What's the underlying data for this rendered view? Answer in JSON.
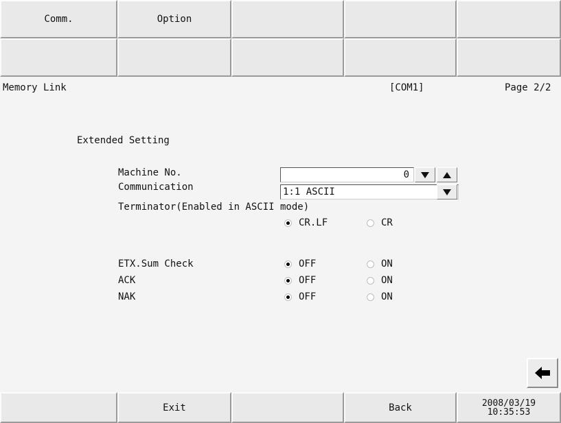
{
  "top_tabs": [
    "Comm.",
    "Option",
    "",
    "",
    ""
  ],
  "second_row": [
    "",
    "",
    "",
    "",
    ""
  ],
  "header": {
    "title": "Memory Link",
    "port": "[COM1]",
    "page": "Page 2/2"
  },
  "section_title": "Extended Setting",
  "machine_no": {
    "label": "Machine No.",
    "value": "0"
  },
  "communication": {
    "label": "Communication",
    "value": "1:1 ASCII"
  },
  "terminator": {
    "label": "Terminator(Enabled in ASCII mode)",
    "options": [
      "CR.LF",
      "CR"
    ],
    "selected": "CR.LF"
  },
  "etx_sum_check": {
    "label": "ETX.Sum Check",
    "options": [
      "OFF",
      "ON"
    ],
    "selected": "OFF"
  },
  "ack": {
    "label": "ACK",
    "options": [
      "OFF",
      "ON"
    ],
    "selected": "OFF"
  },
  "nak": {
    "label": "NAK",
    "options": [
      "OFF",
      "ON"
    ],
    "selected": "OFF"
  },
  "bottom": {
    "exit": "Exit",
    "back": "Back",
    "date": "2008/03/19",
    "time": "10:35:53"
  },
  "icons": {
    "spin_down": "triangle-down-icon",
    "spin_up": "triangle-up-icon",
    "dropdown": "triangle-down-icon",
    "back_arrow": "arrow-left-icon"
  }
}
